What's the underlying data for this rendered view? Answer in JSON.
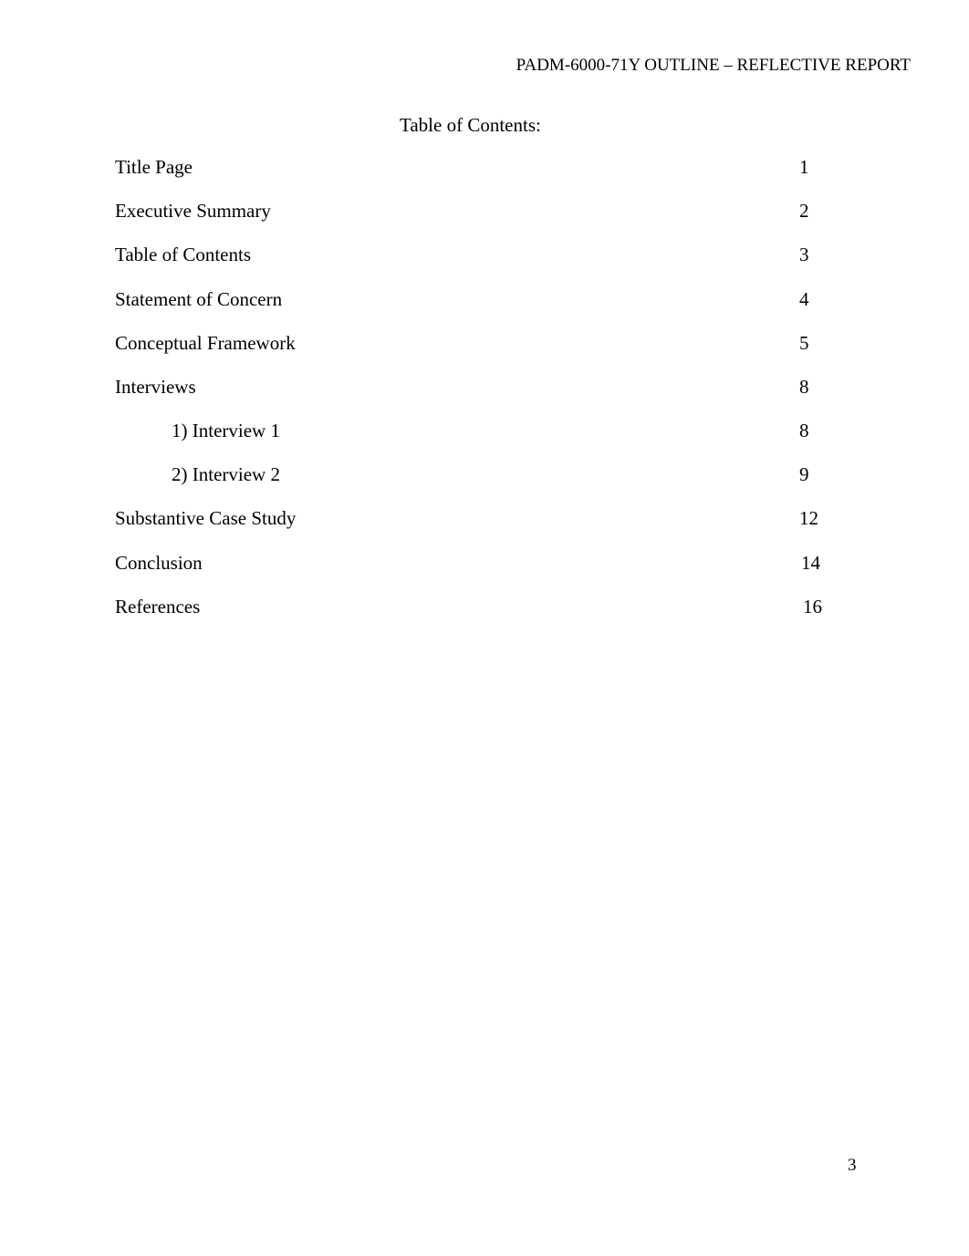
{
  "header": {
    "running_head": "PADM-6000-71Y OUTLINE – REFLECTIVE REPORT"
  },
  "toc": {
    "title": "Table of Contents:",
    "entries": [
      {
        "label": "Title Page",
        "page": "1",
        "level": 1
      },
      {
        "label": "Executive Summary",
        "page": "2",
        "level": 1
      },
      {
        "label": "Table of Contents",
        "page": "3",
        "level": 1
      },
      {
        "label": "Statement of Concern",
        "page": "4",
        "level": 1
      },
      {
        "label": "Conceptual Framework",
        "page": "5",
        "level": 1
      },
      {
        "label": "Interviews",
        "page": "8",
        "level": 1
      },
      {
        "label": "1) Interview 1",
        "page": "8",
        "level": 2
      },
      {
        "label": "2) Interview 2",
        "page": "9",
        "level": 2
      },
      {
        "label": "Substantive Case Study",
        "page": "12",
        "level": 1
      },
      {
        "label": "Conclusion",
        "page": "14",
        "level": 1
      },
      {
        "label": "References",
        "page": "16",
        "level": 1
      }
    ]
  },
  "footer": {
    "page_number": "3"
  }
}
